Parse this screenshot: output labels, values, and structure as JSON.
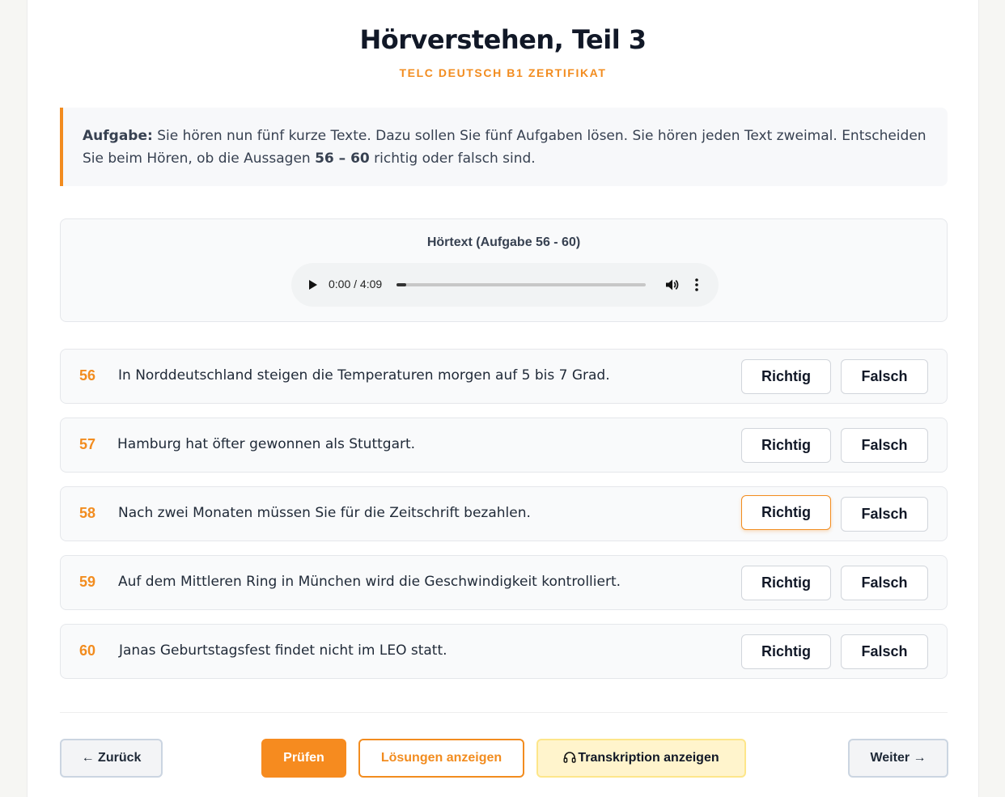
{
  "header": {
    "title": "Hörverstehen, Teil 3",
    "subtitle": "TELC DEUTSCH B1 ZERTIFIKAT"
  },
  "task": {
    "label": "Aufgabe:",
    "text_before": " Sie hören nun fünf kurze Texte. Dazu sollen Sie fünf Aufgaben lösen. Sie hören jeden Text zweimal. Entscheiden Sie beim Hören, ob die Aussagen ",
    "range": "56 – 60",
    "text_after": " richtig oder falsch sind."
  },
  "audio": {
    "label": "Hörtext (Aufgabe 56 - 60)",
    "time": "0:00 / 4:09",
    "progress": 0.04
  },
  "questions": [
    {
      "num": "56",
      "text": "In Norddeutschland steigen die Temperaturen morgen auf 5 bis 7 Grad.",
      "selected": ""
    },
    {
      "num": "57",
      "text": "Hamburg hat öfter gewonnen als Stuttgart.",
      "selected": ""
    },
    {
      "num": "58",
      "text": "Nach zwei Monaten müssen Sie für die Zeitschrift bezahlen.",
      "selected": "richtig"
    },
    {
      "num": "59",
      "text": "Auf dem Mittleren Ring in München wird die Geschwindigkeit kontrolliert.",
      "selected": ""
    },
    {
      "num": "60",
      "text": "Janas Geburtstagsfest findet nicht im LEO statt.",
      "selected": ""
    }
  ],
  "options": {
    "richtig": "Richtig",
    "falsch": "Falsch"
  },
  "footer": {
    "back": "← Zurück",
    "check": "Prüfen",
    "solutions": "Lösungen anzeigen",
    "transcript": "Transkription anzeigen",
    "next": "Weiter →"
  },
  "colors": {
    "accent": "#f28c1f",
    "transcript_bg": "#fff4cc"
  }
}
